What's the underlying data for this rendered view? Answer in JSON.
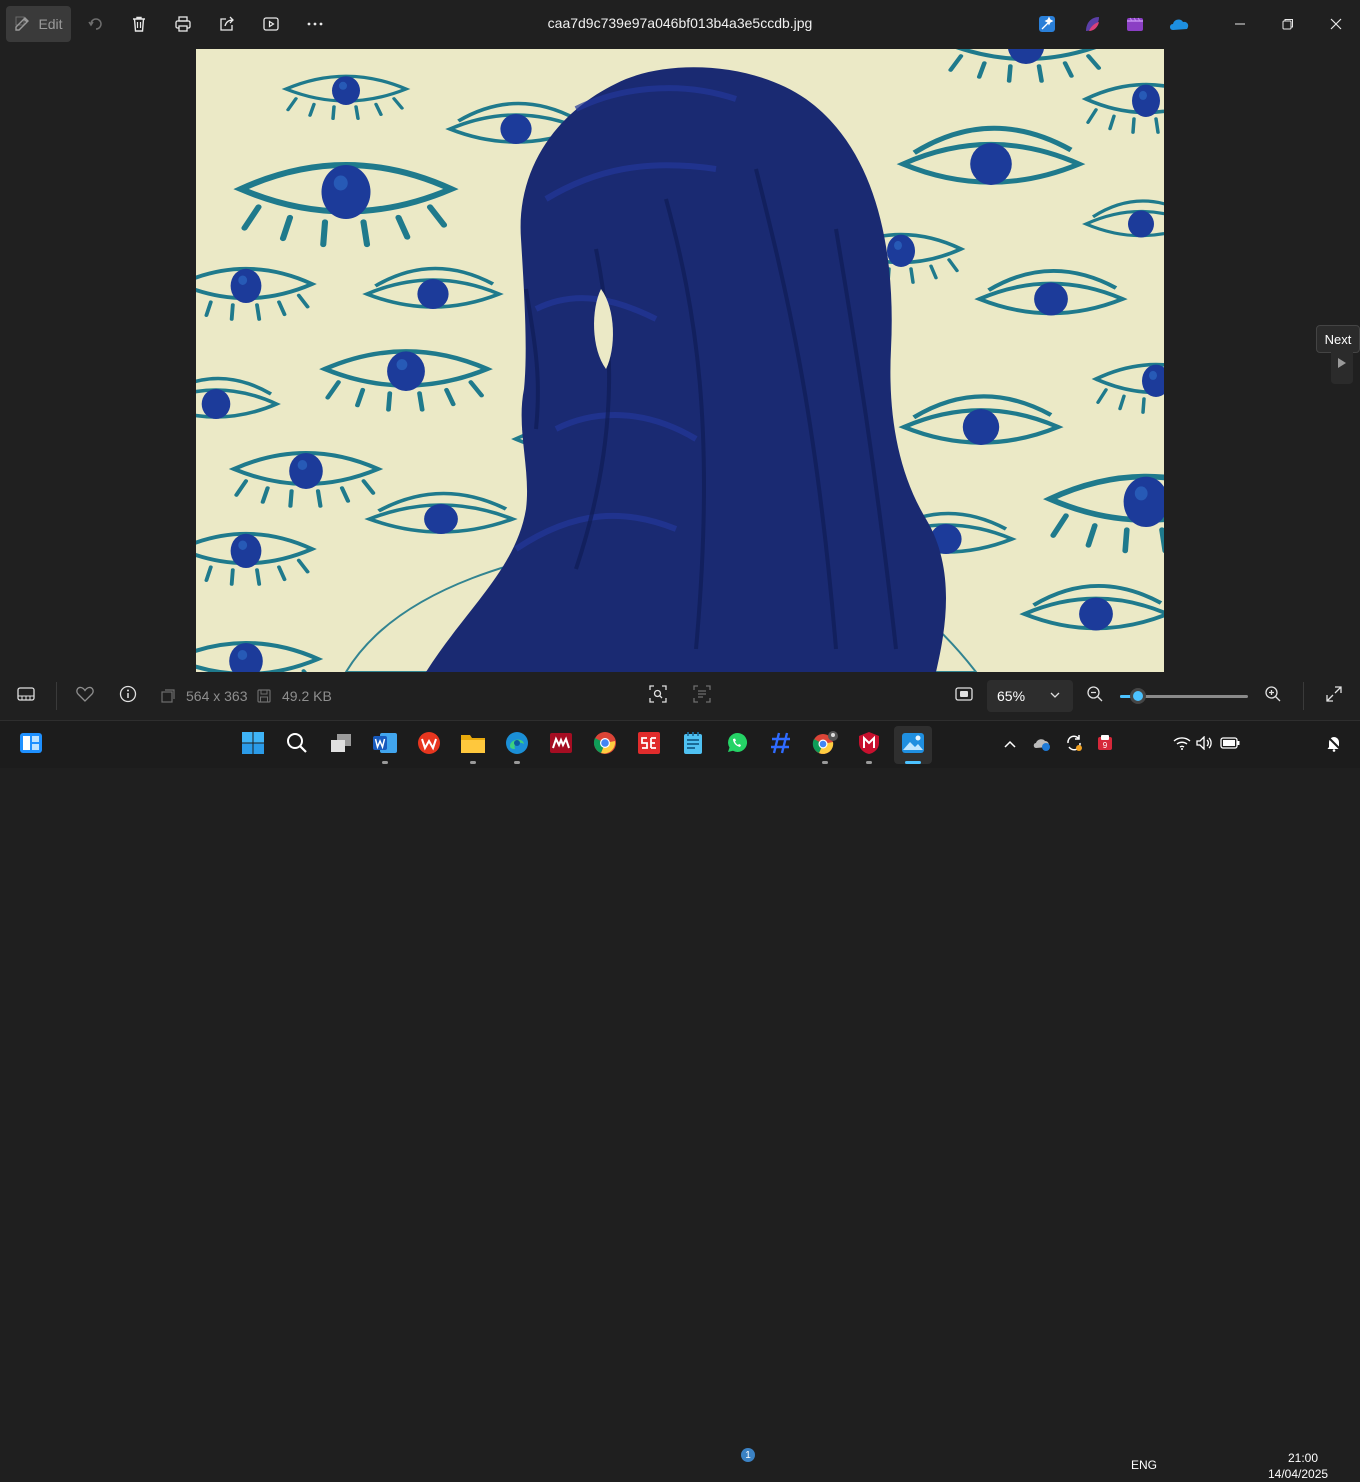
{
  "toolbar": {
    "edit_label": "Edit",
    "filename": "caa7d9c739e97a046bf013b4a3e5ccdb.jpg",
    "icons": [
      "edit-icon",
      "rotate-icon",
      "delete-icon",
      "print-icon",
      "share-icon",
      "slideshow-icon",
      "more-icon"
    ],
    "apps": [
      "designer-icon",
      "clipchamp-icon",
      "video-editor-icon",
      "onedrive-icon"
    ],
    "window_controls": [
      "minimize-icon",
      "maximize-icon",
      "close-icon"
    ]
  },
  "viewer": {
    "next_tooltip": "Next"
  },
  "status": {
    "dimensions": "564 x 363",
    "file_size": "49.2 KB",
    "zoom": "65%",
    "zoom_level": 0.14
  },
  "taskbar": {
    "apps": [
      "start",
      "search",
      "task-view",
      "word",
      "wps-office",
      "file-explorer",
      "edge",
      "mendeley",
      "chrome",
      "sejda",
      "notepad",
      "whatsapp",
      "calculator",
      "chrome-profile",
      "mcafee",
      "photos"
    ],
    "whatsapp_badge": "1",
    "language": "ENG",
    "time": "21:00",
    "date": "14/04/2025"
  },
  "colors": {
    "accent": "#4cc2ff",
    "background": "#202020",
    "paper": "#ebe9c6",
    "ink": "#1a2a72",
    "eye_outline": "#1f7a8c"
  }
}
